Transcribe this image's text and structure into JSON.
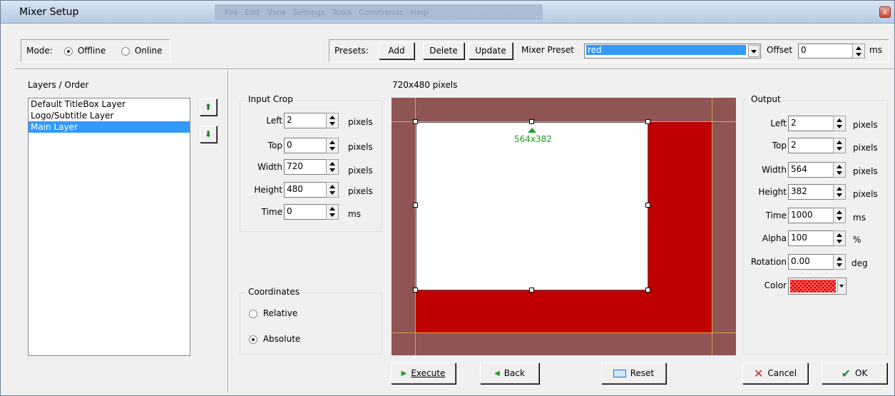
{
  "window": {
    "title": "Mixer Setup",
    "ghost_menu": [
      "File",
      "Edit",
      "View",
      "Settings",
      "Tools",
      "Commands",
      "Help"
    ],
    "close": "x"
  },
  "mode": {
    "label": "Mode:",
    "options": [
      "Offline",
      "Online"
    ],
    "selected": "Offline"
  },
  "presets": {
    "label": "Presets:",
    "add": "Add",
    "delete": "Delete",
    "update": "Update",
    "mixer_preset_label": "Mixer Preset",
    "mixer_preset_value": "red",
    "offset_label": "Offset",
    "offset_value": "0",
    "offset_unit": "ms"
  },
  "layers": {
    "title": "Layers / Order",
    "items": [
      "Default TitleBox Layer",
      "Logo/Subtitle Layer",
      "Main Layer"
    ],
    "selected": "Main Layer"
  },
  "input_crop": {
    "title": "Input Crop",
    "fields": [
      {
        "label": "Left",
        "value": "2",
        "unit": "pixels"
      },
      {
        "label": "Top",
        "value": "0",
        "unit": "pixels"
      },
      {
        "label": "Width",
        "value": "720",
        "unit": "pixels"
      },
      {
        "label": "Height",
        "value": "480",
        "unit": "pixels"
      },
      {
        "label": "Time",
        "value": "0",
        "unit": "ms"
      }
    ]
  },
  "coordinates": {
    "title": "Coordinates",
    "options": [
      "Relative",
      "Absolute"
    ],
    "selected": "Absolute"
  },
  "preview": {
    "size_label": "720x480 pixels",
    "layer_size": "564x382",
    "colors": {
      "border": "#8f5454",
      "layer": "#bf0000",
      "content": "#ffffff",
      "guide": "#d8a64a"
    }
  },
  "output": {
    "title": "Output",
    "fields": [
      {
        "label": "Left",
        "value": "2",
        "unit": "pixels"
      },
      {
        "label": "Top",
        "value": "2",
        "unit": "pixels"
      },
      {
        "label": "Width",
        "value": "564",
        "unit": "pixels"
      },
      {
        "label": "Height",
        "value": "382",
        "unit": "pixels"
      },
      {
        "label": "Time",
        "value": "1000",
        "unit": "ms"
      },
      {
        "label": "Alpha",
        "value": "100",
        "unit": "%"
      },
      {
        "label": "Rotation",
        "value": "0.00",
        "unit": "deg"
      }
    ],
    "color_label": "Color",
    "color_value": "#e00000"
  },
  "buttons": {
    "execute": "Execute",
    "back": "Back",
    "reset": "Reset",
    "cancel": "Cancel",
    "ok": "OK"
  }
}
